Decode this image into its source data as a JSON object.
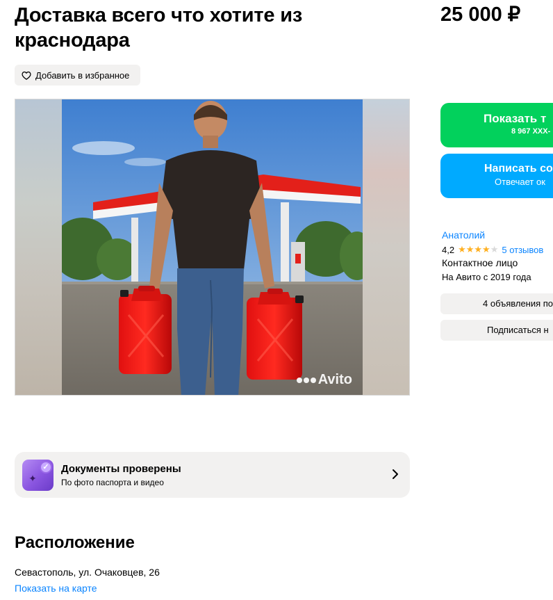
{
  "listing": {
    "title": "Доставка всего что хотите из краснодара",
    "price": "25 000 ₽",
    "favorite_label": "Добавить в избранное",
    "photo_watermark": "Avito"
  },
  "actions": {
    "show_phone_label": "Показать т",
    "phone_masked": "8 967 XXX-",
    "message_label": "Написать со",
    "message_sub": "Отвечает ок"
  },
  "seller": {
    "name": "Анатолий",
    "rating": "4,2",
    "stars_filled": 4,
    "stars_total": 5,
    "reviews": "5 отзывов",
    "role": "Контактное лицо",
    "since": "На Авито с 2019 года",
    "ads_button": "4 объявления по",
    "subscribe_button": "Подписаться н"
  },
  "verification": {
    "title": "Документы проверены",
    "subtitle": "По фото паспорта и видео"
  },
  "location": {
    "heading": "Расположение",
    "address": "Севастополь, ул. Очаковцев, 26",
    "map_link": "Показать на карте"
  },
  "colors": {
    "green_button": "#02d15c",
    "blue_button": "#00aaff",
    "link": "#0a84ff",
    "star": "#ffb021",
    "chip_bg": "#f2f1f0"
  },
  "icons": [
    "heart-icon",
    "avito-logo-icon",
    "verified-documents-icon",
    "chevron-right-icon",
    "star-icon"
  ]
}
